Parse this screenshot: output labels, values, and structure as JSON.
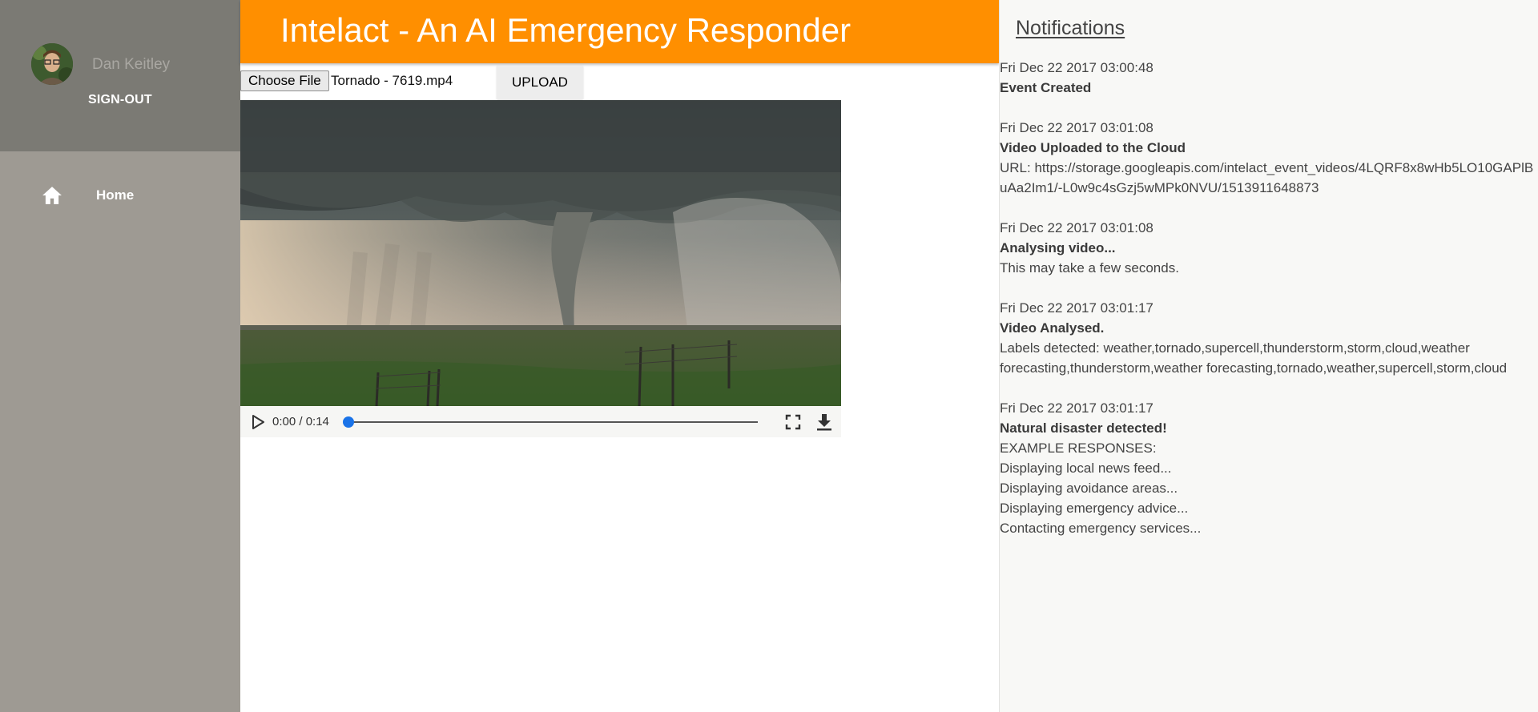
{
  "sidebar": {
    "user_name": "Dan Keitley",
    "signout_label": "SIGN-OUT",
    "nav": [
      {
        "icon": "home-icon",
        "label": "Home"
      }
    ]
  },
  "header": {
    "title": "Intelact - An AI Emergency Responder"
  },
  "upload": {
    "choose_label": "Choose File",
    "file_name": "Tornado - 7619.mp4",
    "button_label": "UPLOAD"
  },
  "video": {
    "time": "0:00 / 0:14",
    "progress": 0
  },
  "notifications": {
    "title": "Notifications",
    "items": [
      {
        "timestamp": "Fri Dec 22 2017 03:00:48",
        "heading": "Event Created",
        "lines": []
      },
      {
        "timestamp": "Fri Dec 22 2017 03:01:08",
        "heading": "Video Uploaded to the Cloud",
        "lines": [
          "URL: https://storage.googleapis.com/intelact_event_videos/4LQRF8x8wHb5LO10GAPlBuAa2Im1/-L0w9c4sGzj5wMPk0NVU/1513911648873"
        ]
      },
      {
        "timestamp": "Fri Dec 22 2017 03:01:08",
        "heading": "Analysing video...",
        "lines": [
          "This may take a few seconds."
        ]
      },
      {
        "timestamp": "Fri Dec 22 2017 03:01:17",
        "heading": "Video Analysed.",
        "lines": [
          "Labels detected: weather,tornado,supercell,thunderstorm,storm,cloud,weather forecasting,thunderstorm,weather forecasting,tornado,weather,supercell,storm,cloud"
        ]
      },
      {
        "timestamp": "Fri Dec 22 2017 03:01:17",
        "heading": "Natural disaster detected!",
        "lines": [
          "EXAMPLE RESPONSES:",
          "Displaying local news feed...",
          "Displaying avoidance areas...",
          "Displaying emergency advice...",
          "Contacting emergency services..."
        ]
      }
    ]
  }
}
